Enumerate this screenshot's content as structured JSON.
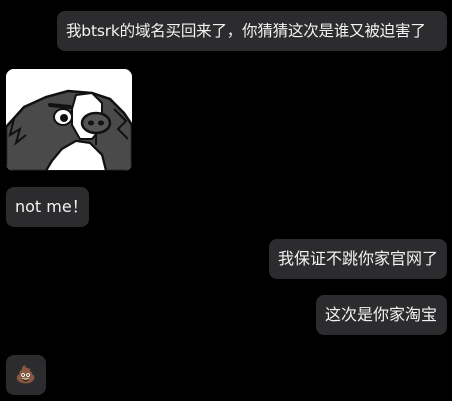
{
  "chat": {
    "messages": [
      {
        "side": "right",
        "type": "text",
        "text": "我btsrk的域名买回来了，你猜猜这次是谁又被迫害了"
      },
      {
        "side": "left",
        "type": "sticker",
        "sticker": "cartoon-dog-face"
      },
      {
        "side": "left",
        "type": "text",
        "text": "not me！"
      },
      {
        "side": "right",
        "type": "text",
        "text": "我保证不跳你家官网了"
      },
      {
        "side": "right",
        "type": "text",
        "text": "这次是你家淘宝"
      },
      {
        "side": "left",
        "type": "emoji",
        "text": "💩",
        "icon": "poop-emoji"
      }
    ]
  },
  "colors": {
    "background": "#000000",
    "bubble": "#2c2c2e",
    "text": "#f2f2f2"
  }
}
